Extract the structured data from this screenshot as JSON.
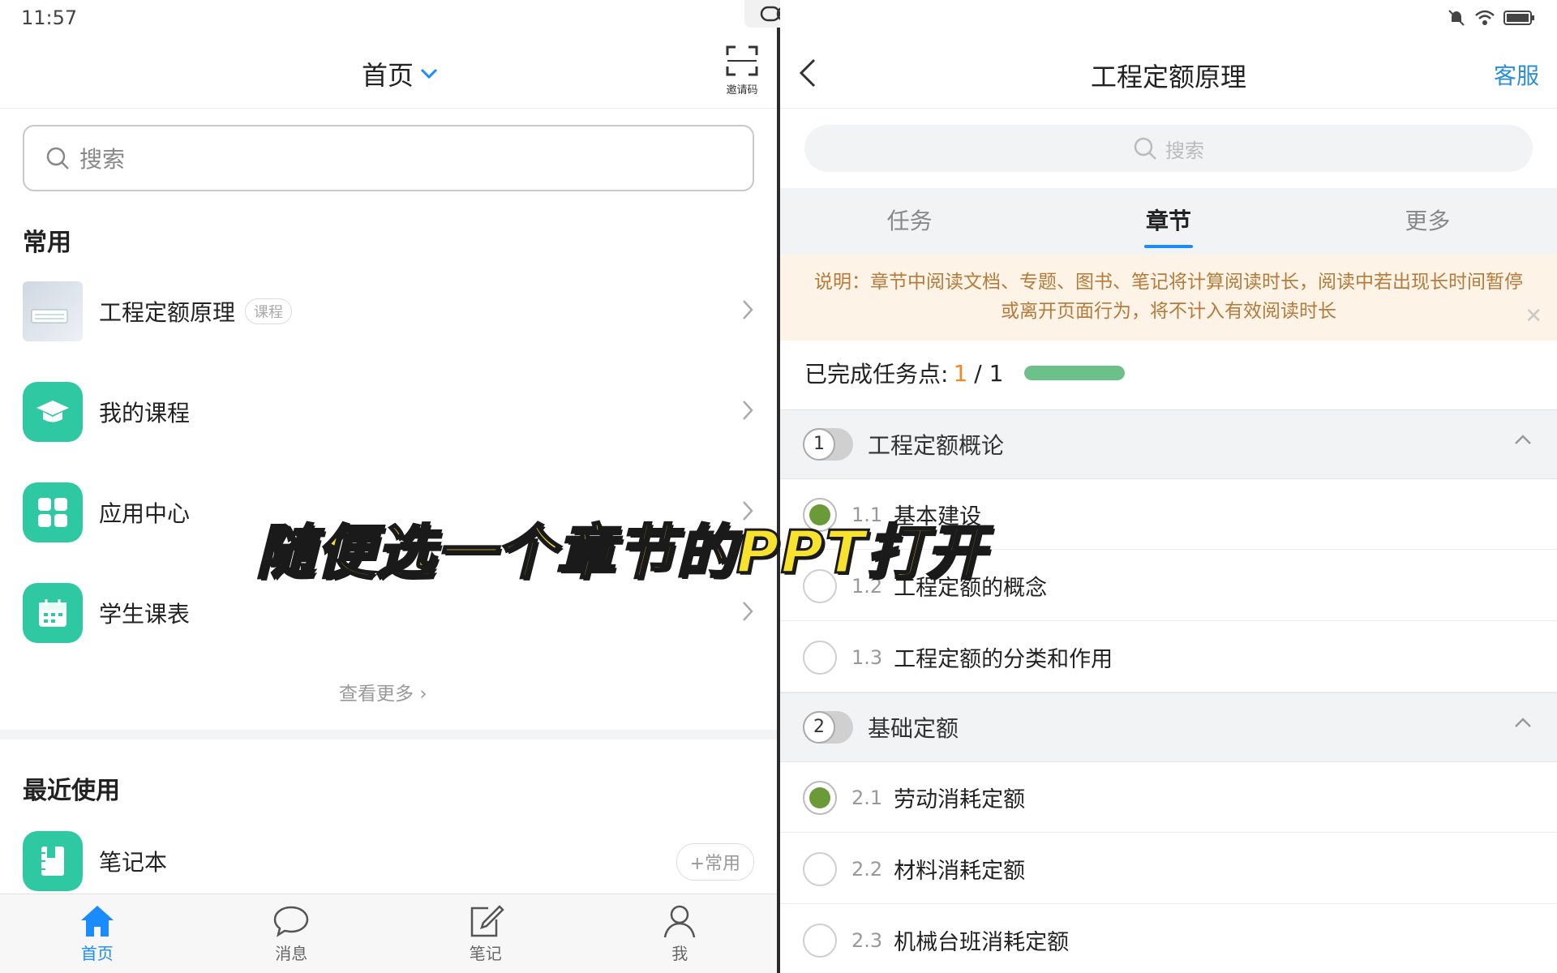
{
  "status": {
    "time": "11:57"
  },
  "left": {
    "title": "首页",
    "invite_label": "邀请码",
    "search_placeholder": "搜索",
    "common_title": "常用",
    "items": [
      {
        "label": "工程定额原理",
        "tag": "课程",
        "icon": "course-thumbnail"
      },
      {
        "label": "我的课程",
        "icon": "graduation-cap-icon"
      },
      {
        "label": "应用中心",
        "icon": "grid-apps-icon"
      },
      {
        "label": "学生课表",
        "icon": "calendar-icon"
      }
    ],
    "see_more": "查看更多",
    "recent_title": "最近使用",
    "recent_items": [
      {
        "label": "笔记本",
        "action": "+常用",
        "icon": "notebook-icon"
      }
    ],
    "tabs": [
      {
        "label": "首页",
        "icon": "home-icon",
        "active": true
      },
      {
        "label": "消息",
        "icon": "chat-bubble-icon"
      },
      {
        "label": "笔记",
        "icon": "edit-note-icon"
      },
      {
        "label": "我",
        "icon": "person-icon"
      }
    ],
    "accent": "#1a8cff",
    "icon_color": "#2ec9a3"
  },
  "right": {
    "title": "工程定额原理",
    "service": "客服",
    "search_placeholder": "搜索",
    "segments": [
      "任务",
      "章节",
      "更多"
    ],
    "selected_segment": "章节",
    "notice": "说明：章节中阅读文档、专题、图书、笔记将计算阅读时长，阅读中若出现长时间暂停或离开页面行为，将不计入有效阅读时长",
    "progress_label": "已完成任务点:",
    "progress_done": "1",
    "progress_sep": "/ 1",
    "progress_fraction": 1.0,
    "chapters": [
      {
        "num": "1",
        "title": "工程定额概论",
        "sections": [
          {
            "no": "1.1",
            "title": "基本建设",
            "done": true
          },
          {
            "no": "1.2",
            "title": "工程定额的概念",
            "done": false
          },
          {
            "no": "1.3",
            "title": "工程定额的分类和作用",
            "done": false
          }
        ]
      },
      {
        "num": "2",
        "title": "基础定额",
        "sections": [
          {
            "no": "2.1",
            "title": "劳动消耗定额",
            "done": true
          },
          {
            "no": "2.2",
            "title": "材料消耗定额",
            "done": false
          },
          {
            "no": "2.3",
            "title": "机械台班消耗定额",
            "done": false
          }
        ]
      }
    ]
  },
  "overlay_caption": "随便选一个章节的PPT打开"
}
